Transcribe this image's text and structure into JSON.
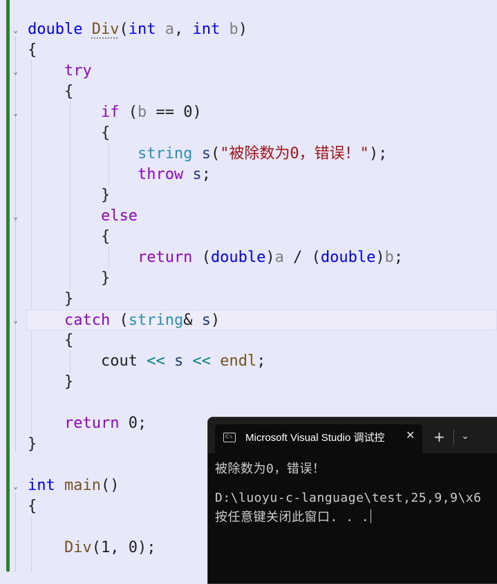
{
  "editor": {
    "lines": {
      "l1": [
        "double",
        "Div",
        "(",
        "int",
        "a",
        ", ",
        "int",
        "b",
        ")"
      ],
      "l2": "{",
      "l3": "try",
      "l4": "{",
      "l5": [
        "if",
        " (",
        "b",
        " == ",
        "0",
        ")"
      ],
      "l6": "{",
      "l7": [
        "string",
        "s",
        "(",
        "\"被除数为0，错误！\"",
        ");"
      ],
      "l8": [
        "throw",
        "s",
        ";"
      ],
      "l9": "}",
      "l10": "else",
      "l11": "{",
      "l12": [
        "return",
        "(",
        "double",
        ")",
        "a",
        " / ",
        "(",
        "double",
        ")",
        "b",
        ";"
      ],
      "l13": "}",
      "l14": "}",
      "l15": [
        "catch",
        " (",
        "string",
        "&",
        "s",
        ")"
      ],
      "l16": "{",
      "l17": [
        "cout",
        "<<",
        "s",
        "<<",
        "endl",
        ";"
      ],
      "l18": "}",
      "l20": [
        "return",
        "0",
        ";"
      ],
      "l21": "}",
      "l23": [
        "int",
        "main",
        "()"
      ],
      "l24": "{",
      "l26": [
        "Div",
        "(1, 0);"
      ]
    },
    "colors": {
      "keyword": "#0000ff",
      "control": "#8f08c4",
      "type": "#2b91af",
      "function": "#74531f",
      "parameter": "#808080",
      "string": "#a31515",
      "background": "#e8e8fb",
      "change_bar": "#1f8a1f"
    }
  },
  "console": {
    "tab_icon_text": "C:\\",
    "tab_title": "Microsoft Visual Studio 调试控",
    "output_line_1": "被除数为0，错误！",
    "output_line_2": "D:\\luoyu-c-language\\test,25,9,9\\x6",
    "output_line_3": "按任意键关闭此窗口. . .",
    "icons": {
      "tab": "console-icon",
      "close": "close-icon",
      "new_tab": "plus-icon",
      "dropdown": "chevron-down-icon"
    }
  }
}
